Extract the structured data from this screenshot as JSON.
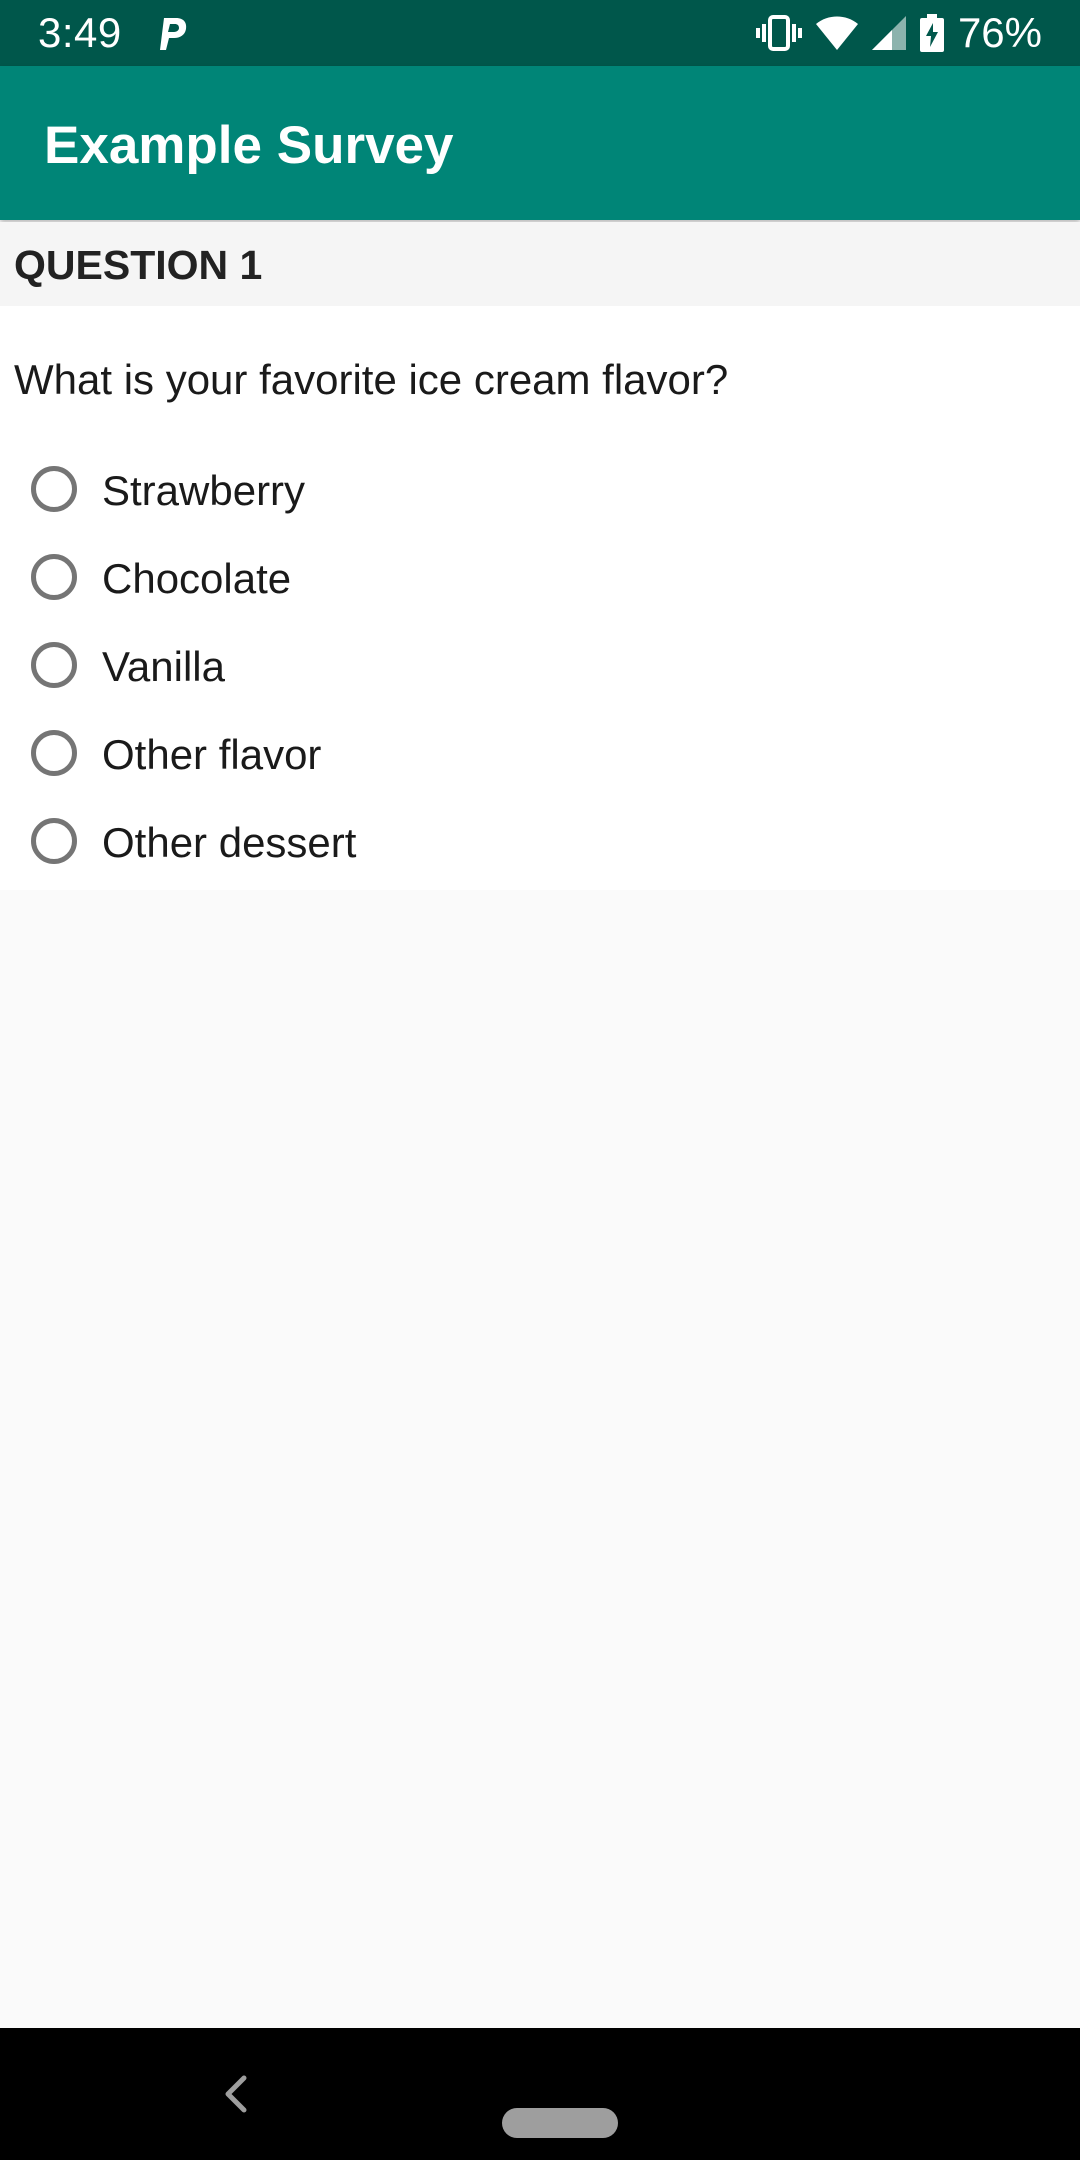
{
  "status_bar": {
    "time": "3:49",
    "battery_percent": "76%",
    "icons": [
      "parking-notification-icon",
      "vibrate-icon",
      "wifi-icon",
      "signal-icon",
      "battery-charging-icon"
    ]
  },
  "app_bar": {
    "title": "Example Survey",
    "color": "#008577"
  },
  "question": {
    "header": "QUESTION 1",
    "text": "What is your favorite ice cream flavor?",
    "options": [
      {
        "label": "Strawberry",
        "selected": false
      },
      {
        "label": "Chocolate",
        "selected": false
      },
      {
        "label": "Vanilla",
        "selected": false
      },
      {
        "label": "Other flavor",
        "selected": false
      },
      {
        "label": "Other dessert",
        "selected": false
      }
    ]
  },
  "nav_bar": {
    "icons": [
      "back-icon",
      "home-pill-icon"
    ]
  },
  "colors": {
    "status_bar": "#00574b",
    "app_bar": "#008577",
    "radio_outline": "#757575"
  }
}
